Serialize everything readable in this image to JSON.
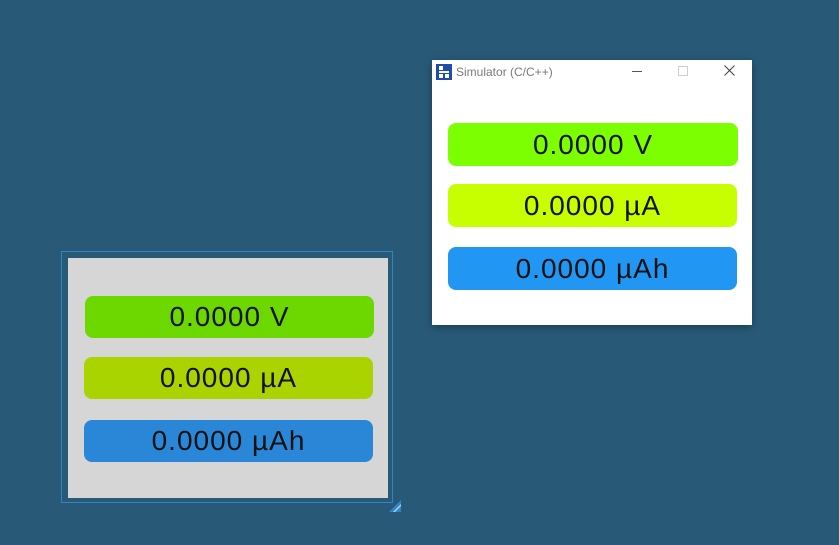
{
  "simulator": {
    "title": "Simulator (C/C++)",
    "icon": "simulator-app-icon",
    "controls": [
      "minimize-icon",
      "maximize-icon",
      "close-icon"
    ]
  },
  "readings": {
    "voltage": "0.0000 V",
    "current": "0.0000 µA",
    "charge": "0.0000 µAh"
  },
  "colors": {
    "desktop_background": "#285a78",
    "design_screen_background": "#d6d6d6",
    "design_voltage_bar": "#6cd800",
    "design_current_bar": "#aad400",
    "design_charge_bar": "#2a86d6",
    "sim_voltage_bar": "#7cff00",
    "sim_current_bar": "#c8ff00",
    "sim_charge_bar": "#2196f3",
    "selection_border": "#2e86c8"
  }
}
